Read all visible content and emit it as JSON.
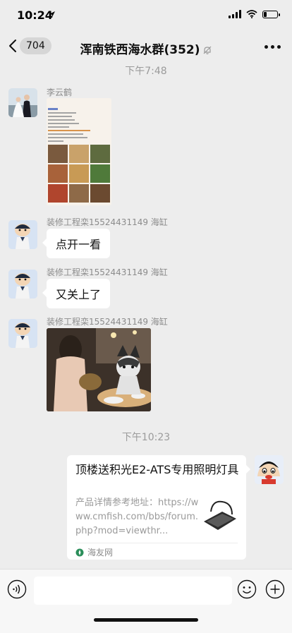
{
  "status_bar": {
    "time": "10:24",
    "battery_level": 0.25
  },
  "nav": {
    "back_count": "704",
    "title": "浑南铁西海水群(352)",
    "muted": true
  },
  "messages": {
    "time_1": "下午7:48",
    "time_2": "下午10:23",
    "m1_sender": "李云鹤",
    "m2_sender": "装修工程栾15524431149 海缸",
    "m2_text": "点开一看",
    "m3_sender": "装修工程栾15524431149 海缸",
    "m3_text": "又关上了",
    "m4_sender": "装修工程栾15524431149 海缸"
  },
  "link_card": {
    "title": "顶楼送积光E2-ATS专用照明灯具",
    "description": "产品详情参考地址：https://www.cmfish.com/bbs/forum.php?mod=viewthr...",
    "source": "海友网"
  },
  "icons": {
    "back": "chevron-left-icon",
    "mute": "bell-off-icon",
    "more": "more-dots-icon",
    "voice": "voice-icon",
    "emoji": "emoji-icon",
    "plus": "plus-icon"
  },
  "colors": {
    "background": "#ededed",
    "bubble": "#ffffff",
    "timestamp": "#9b9b9b"
  }
}
